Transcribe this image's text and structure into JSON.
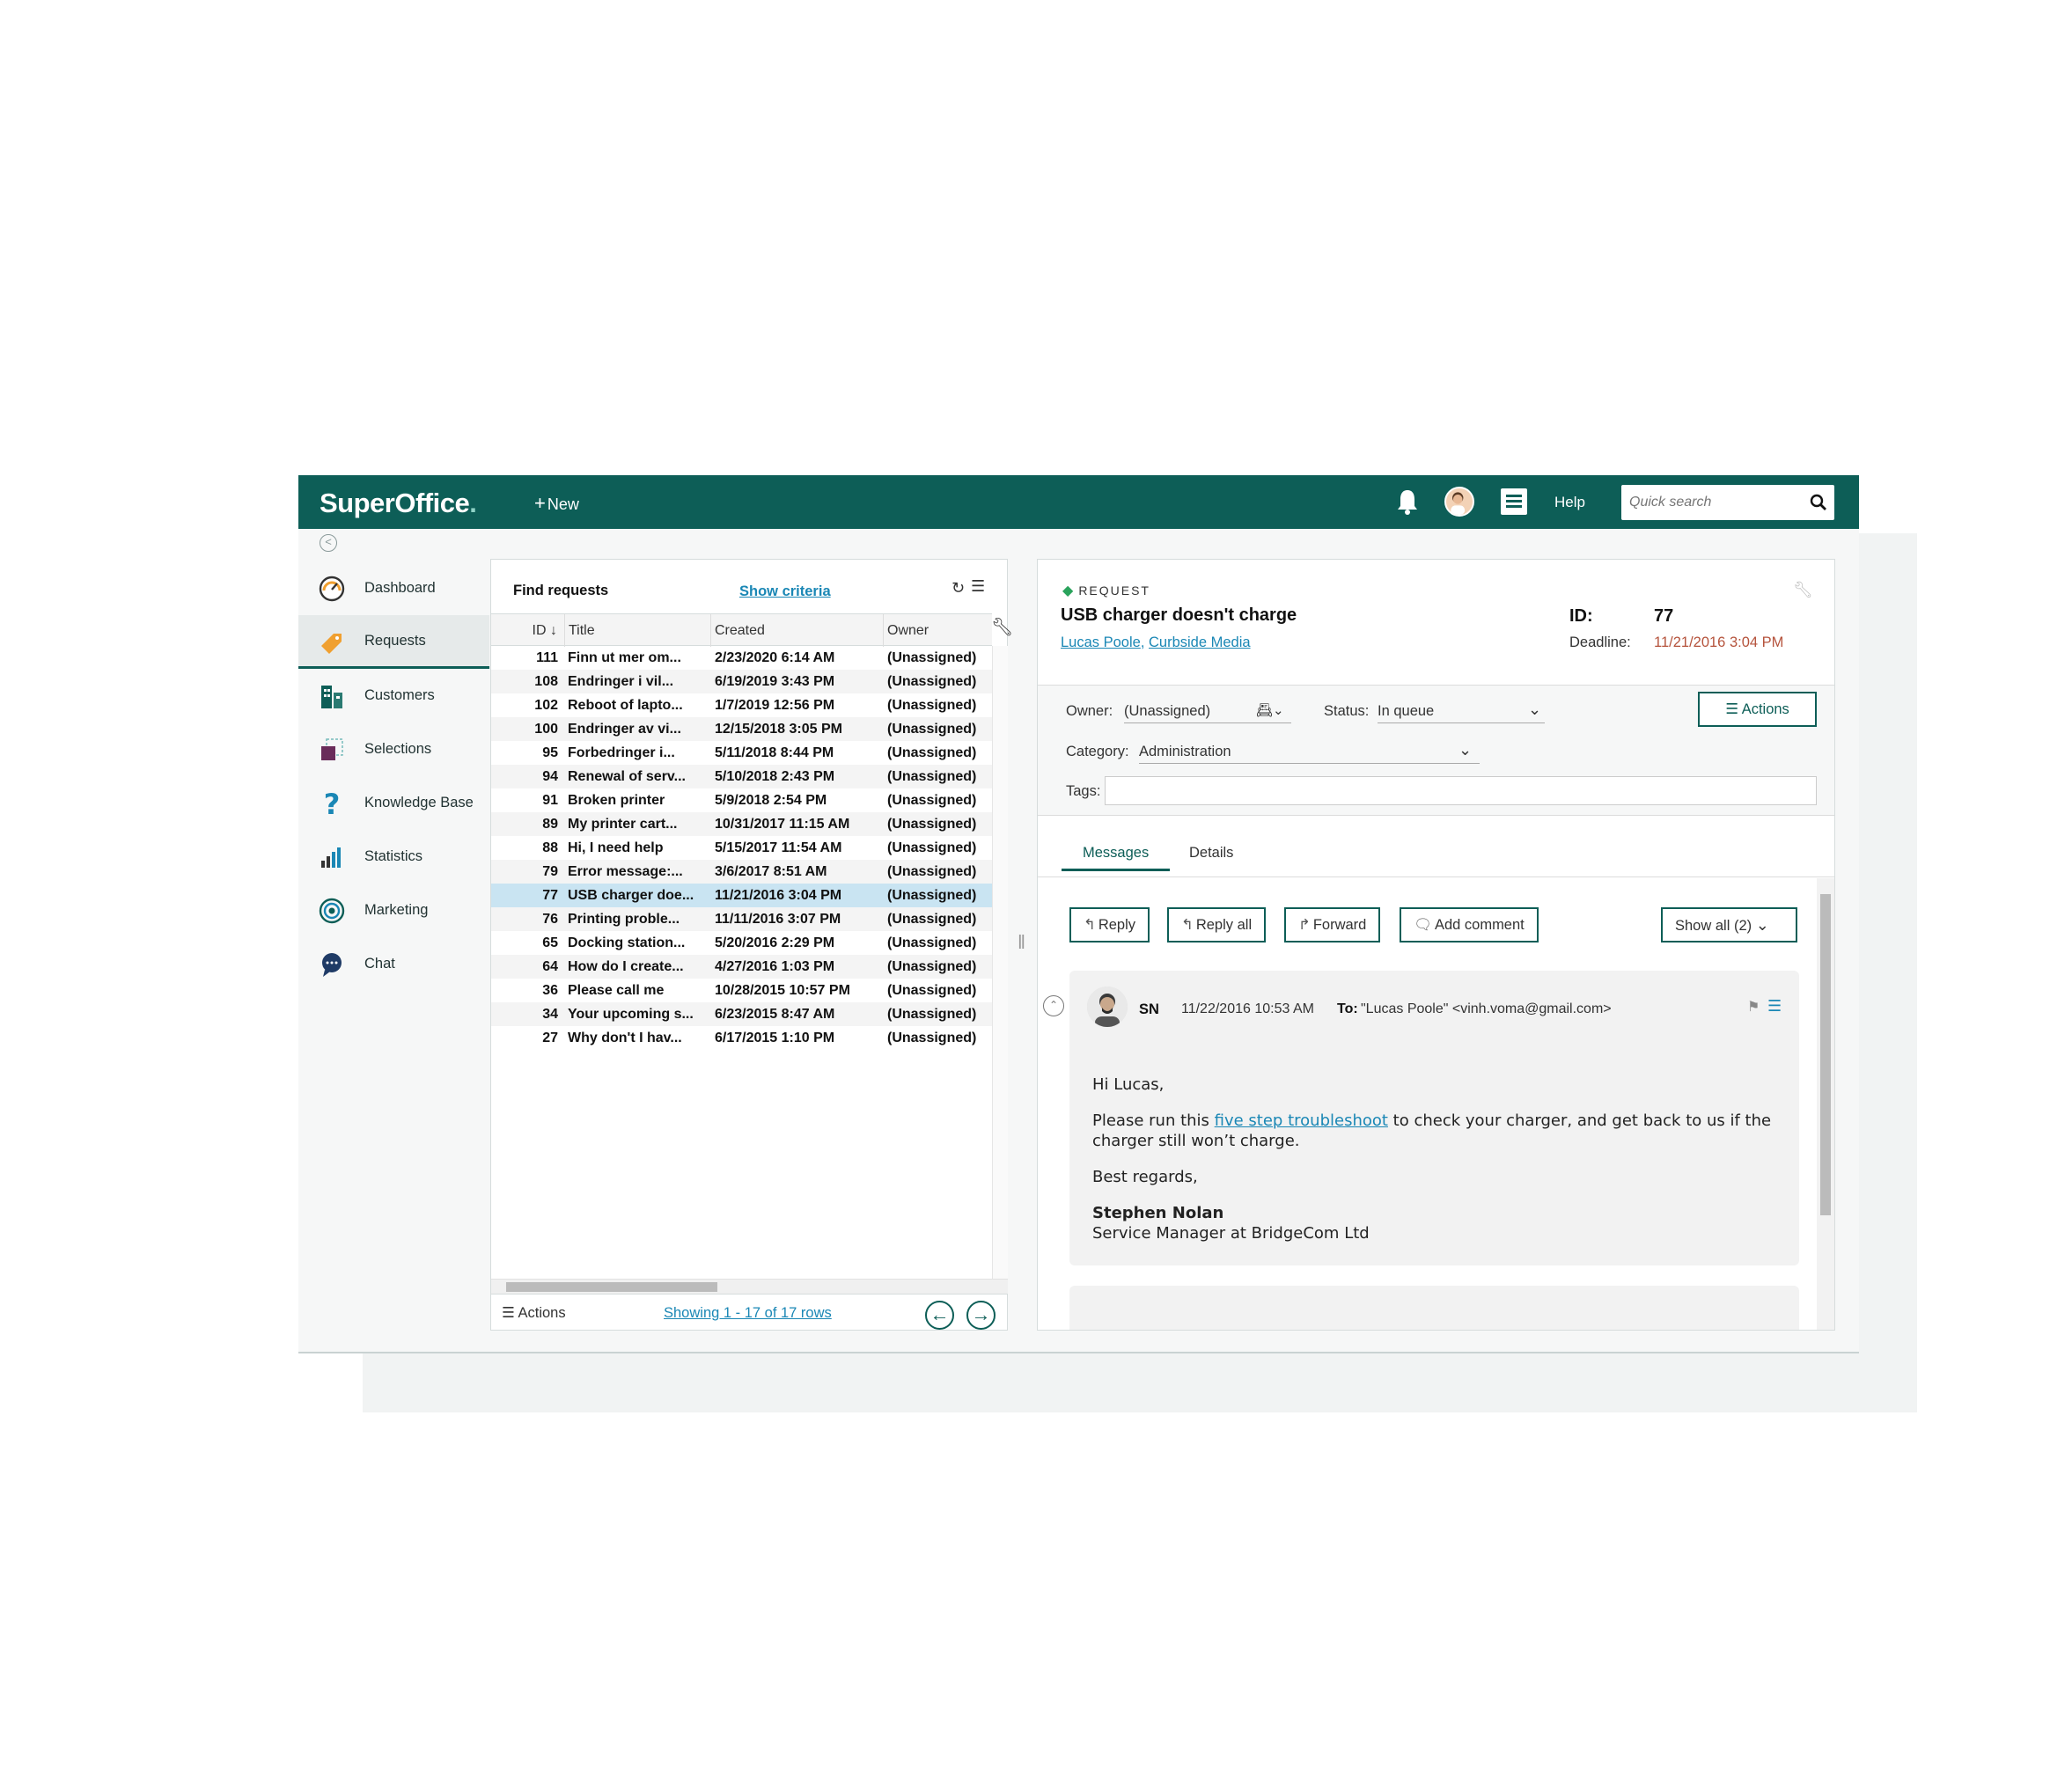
{
  "topbar": {
    "logo": "SuperOffice",
    "logo_dot": ".",
    "new_label": "New",
    "help_label": "Help",
    "search_placeholder": "Quick search"
  },
  "sidebar": {
    "items": [
      {
        "label": "Dashboard",
        "icon": "gauge-icon"
      },
      {
        "label": "Requests",
        "icon": "ticket-icon"
      },
      {
        "label": "Customers",
        "icon": "buildings-icon"
      },
      {
        "label": "Selections",
        "icon": "selection-icon"
      },
      {
        "label": "Knowledge Base",
        "icon": "question-icon"
      },
      {
        "label": "Statistics",
        "icon": "bar-chart-icon"
      },
      {
        "label": "Marketing",
        "icon": "target-icon"
      },
      {
        "label": "Chat",
        "icon": "chat-bubble-icon"
      }
    ],
    "active": "Requests"
  },
  "find_panel": {
    "title": "Find requests",
    "show_criteria": "Show criteria",
    "columns": {
      "id": "ID",
      "sort": "↓",
      "title": "Title",
      "created": "Created",
      "owner": "Owner"
    },
    "rows": [
      {
        "id": "111",
        "title": "Finn ut mer om...",
        "created": "2/23/2020 6:14 AM",
        "owner": "(Unassigned)"
      },
      {
        "id": "108",
        "title": "Endringer i vil...",
        "created": "6/19/2019 3:43 PM",
        "owner": "(Unassigned)"
      },
      {
        "id": "102",
        "title": "Reboot of lapto...",
        "created": "1/7/2019 12:56 PM",
        "owner": "(Unassigned)"
      },
      {
        "id": "100",
        "title": "Endringer av vi...",
        "created": "12/15/2018 3:05 PM",
        "owner": "(Unassigned)"
      },
      {
        "id": "95",
        "title": "Forbedringer i...",
        "created": "5/11/2018 8:44 PM",
        "owner": "(Unassigned)"
      },
      {
        "id": "94",
        "title": "Renewal of serv...",
        "created": "5/10/2018 2:43 PM",
        "owner": "(Unassigned)"
      },
      {
        "id": "91",
        "title": "Broken printer",
        "created": "5/9/2018 2:54 PM",
        "owner": "(Unassigned)"
      },
      {
        "id": "89",
        "title": "My printer cart...",
        "created": "10/31/2017 11:15 AM",
        "owner": "(Unassigned)"
      },
      {
        "id": "88",
        "title": "Hi, I need help",
        "created": "5/15/2017 11:54 AM",
        "owner": "(Unassigned)"
      },
      {
        "id": "79",
        "title": "Error message:...",
        "created": "3/6/2017 8:51 AM",
        "owner": "(Unassigned)"
      },
      {
        "id": "77",
        "title": "USB charger doe...",
        "created": "11/21/2016 3:04 PM",
        "owner": "(Unassigned)"
      },
      {
        "id": "76",
        "title": "Printing proble...",
        "created": "11/11/2016 3:07 PM",
        "owner": "(Unassigned)"
      },
      {
        "id": "65",
        "title": "Docking station...",
        "created": "5/20/2016 2:29 PM",
        "owner": "(Unassigned)"
      },
      {
        "id": "64",
        "title": "How do I create...",
        "created": "4/27/2016 1:03 PM",
        "owner": "(Unassigned)"
      },
      {
        "id": "36",
        "title": "Please call me",
        "created": "10/28/2015 10:57 PM",
        "owner": "(Unassigned)"
      },
      {
        "id": "34",
        "title": "Your upcoming s...",
        "created": "6/23/2015 8:47 AM",
        "owner": "(Unassigned)"
      },
      {
        "id": "27",
        "title": "Why don't I hav...",
        "created": "6/17/2015 1:10 PM",
        "owner": "(Unassigned)"
      }
    ],
    "selected_id": "77",
    "footer": {
      "actions": "Actions",
      "showing": "Showing 1 - 17 of 17 rows"
    }
  },
  "request": {
    "label": "REQUEST",
    "title": "USB charger doesn't charge",
    "contact": "Lucas Poole",
    "company": "Curbside Media",
    "id_label": "ID:",
    "id": "77",
    "deadline_label": "Deadline:",
    "deadline": "11/21/2016 3:04 PM",
    "owner_label": "Owner:",
    "owner": "(Unassigned)",
    "status_label": "Status:",
    "status": "In queue",
    "category_label": "Category:",
    "category": "Administration",
    "tags_label": "Tags:",
    "actions": "Actions",
    "tabs": [
      "Messages",
      "Details"
    ]
  },
  "messages": {
    "buttons": {
      "reply": "Reply",
      "reply_all": "Reply all",
      "forward": "Forward",
      "add_comment": "Add comment",
      "show_all": "Show all (2)"
    },
    "message": {
      "sender": "SN",
      "date": "11/22/2016 10:53 AM",
      "to_label": "To:",
      "to": "\"Lucas Poole\" <vinh.voma@gmail.com>",
      "greeting": "Hi Lucas,",
      "body_before": "Please run this ",
      "link": "five step troubleshoot",
      "body_after": " to check your charger, and get back to us if the charger still won’t charge.",
      "regards": "Best regards,",
      "signature_name": "Stephen Nolan",
      "signature_title": "Service Manager at BridgeCom Ltd"
    }
  },
  "colors": {
    "brand": "#0d5e57",
    "link": "#1a87b5",
    "deadline": "#b5533c",
    "selected_row": "#c9e4f2"
  }
}
